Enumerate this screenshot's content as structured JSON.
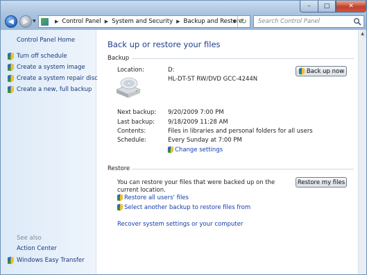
{
  "window": {
    "controls": {
      "minimize": "–",
      "maximize": "□",
      "close": "✕"
    }
  },
  "nav": {
    "back_icon": "back-arrow-icon",
    "forward_icon": "forward-arrow-icon"
  },
  "address_bar": {
    "breadcrumb": [
      "Control Panel",
      "System and Security",
      "Backup and Restore"
    ]
  },
  "search": {
    "placeholder": "Search Control Panel"
  },
  "sidebar": {
    "home": "Control Panel Home",
    "items": [
      {
        "label": "Turn off schedule",
        "icon": "shield-icon"
      },
      {
        "label": "Create a system image",
        "icon": "shield-icon"
      },
      {
        "label": "Create a system repair disc",
        "icon": "shield-icon"
      },
      {
        "label": "Create a new, full backup",
        "icon": "shield-icon"
      }
    ],
    "see_also_title": "See also",
    "see_also": [
      {
        "label": "Action Center"
      },
      {
        "label": "Windows Easy Transfer",
        "icon": "shield-icon"
      }
    ]
  },
  "main": {
    "title": "Back up or restore your files",
    "backup": {
      "heading": "Backup",
      "location_label": "Location:",
      "location_drive": "D:",
      "location_device": "HL-DT-ST RW/DVD GCC-4244N",
      "backup_now_button": "Back up now",
      "next_backup_label": "Next backup:",
      "next_backup_value": "9/20/2009 7:00 PM",
      "last_backup_label": "Last backup:",
      "last_backup_value": "9/18/2009 11:28 AM",
      "contents_label": "Contents:",
      "contents_value": "Files in libraries and personal folders for all users",
      "schedule_label": "Schedule:",
      "schedule_value": "Every Sunday at 7:00 PM",
      "change_settings_link": "Change settings"
    },
    "restore": {
      "heading": "Restore",
      "description": "You can restore your files that were backed up on the current location.",
      "restore_button": "Restore my files",
      "restore_all_link": "Restore all users' files",
      "select_another_link": "Select another backup to restore files from",
      "recover_link": "Recover system settings or your computer"
    }
  },
  "colors": {
    "link": "#0f3cab",
    "title": "#1e3f8a",
    "sidebar_bg": "#e7f0fa",
    "titlebar": "#aac3df"
  }
}
